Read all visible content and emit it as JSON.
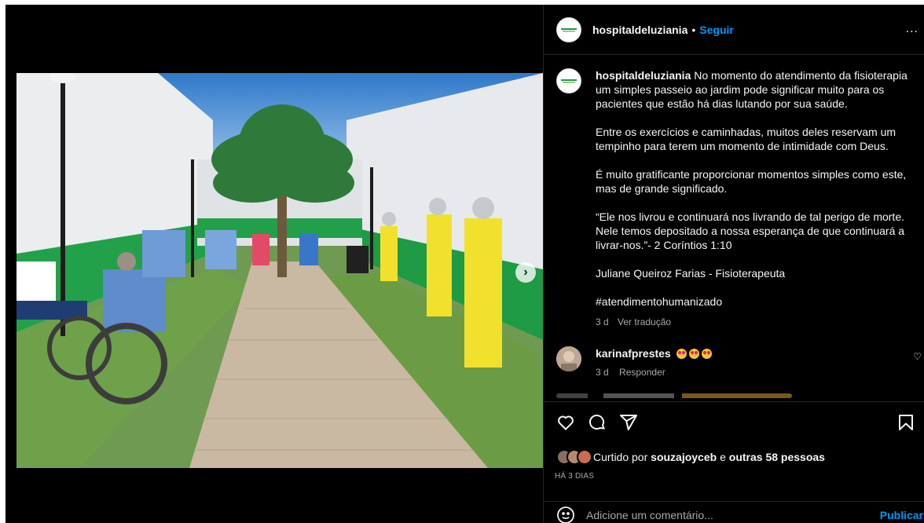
{
  "post": {
    "username": "hospitaldeluziania",
    "separator": "•",
    "follow_label": "Seguir",
    "more_label": "...",
    "logo_text": "HOSPITAL LUZIANIA"
  },
  "caption": {
    "username": "hospitaldeluziania",
    "p1": "No momento do atendimento da fisioterapia um simples passeio ao jardim pode significar muito para os pacientes que estão há dias lutando por sua saúde.",
    "p2": "Entre os exercícios e caminhadas, muitos deles reservam um tempinho para terem um momento de intimidade com Deus.",
    "p3": "É muito gratificante proporcionar momentos simples como este, mas de grande significado.",
    "p4": "“Ele nos livrou e continuará nos livrando de tal perigo de morte. Nele temos depositado a nossa esperança de que continuará a livrar-nos.”- 2 Coríntios 1:10",
    "p5": "Juliane Queiroz Farias - Fisioterapeuta",
    "hashtag": "#atendimentohumanizado",
    "time": "3 d",
    "translate_label": "Ver tradução"
  },
  "comment": {
    "username": "karinafprestes",
    "emoji_count": 3,
    "time": "3 d",
    "reply_label": "Responder"
  },
  "likes": {
    "prefix": "Curtido por",
    "user": "souzajoyceb",
    "joiner": "e",
    "others": "outras 58 pessoas"
  },
  "date_label": "HÁ 3 DIAS",
  "add_comment": {
    "placeholder": "Adicione um comentário...",
    "publish_label": "Publicar"
  },
  "icons": {
    "like": "heart-icon",
    "comment": "comment-icon",
    "share": "share-icon",
    "save": "bookmark-icon",
    "emoji": "smiley-icon",
    "next": "chevron-right-icon"
  },
  "colors": {
    "background": "#000000",
    "link_blue": "#0095f6",
    "muted_text": "#a8a8a8",
    "divider": "#262626"
  },
  "carousel": {
    "current_slide": 1,
    "total_slides": 2
  }
}
